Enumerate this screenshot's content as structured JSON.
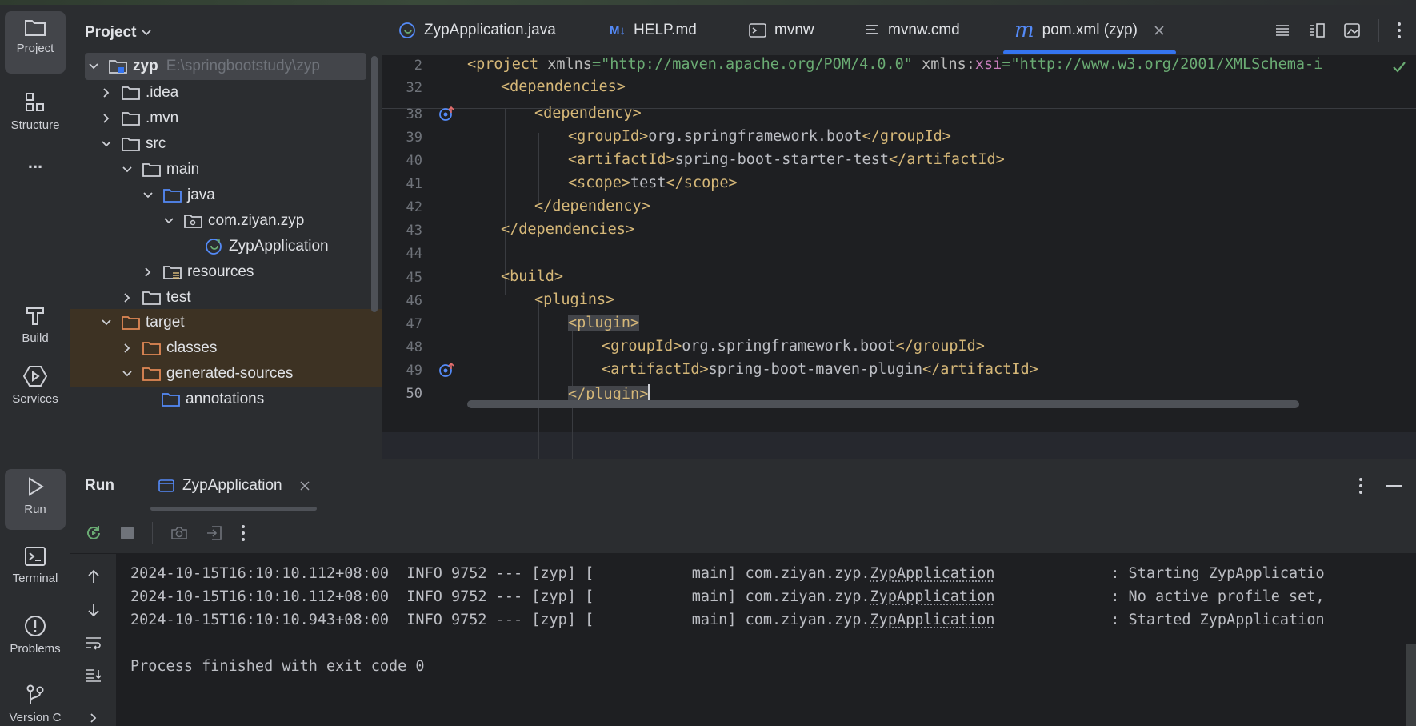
{
  "colors": {
    "accent": "#3574f0",
    "tag": "#d5b778",
    "string": "#6aab73",
    "excluded": "#3d3223"
  },
  "toolstrip": {
    "project": "Project",
    "structure": "Structure",
    "more": "...",
    "build": "Build",
    "services": "Services",
    "run": "Run",
    "terminal": "Terminal",
    "problems": "Problems",
    "version": "Version C"
  },
  "project": {
    "title": "Project",
    "tree": [
      {
        "label": "zyp",
        "path": "E:\\springbootstudy\\zyp"
      },
      {
        "label": ".idea"
      },
      {
        "label": ".mvn"
      },
      {
        "label": "src"
      },
      {
        "label": "main"
      },
      {
        "label": "java"
      },
      {
        "label": "com.ziyan.zyp"
      },
      {
        "label": "ZypApplication"
      },
      {
        "label": "resources"
      },
      {
        "label": "test"
      },
      {
        "label": "target"
      },
      {
        "label": "classes"
      },
      {
        "label": "generated-sources"
      },
      {
        "label": "annotations"
      }
    ]
  },
  "tabs": [
    {
      "label": "ZypApplication.java",
      "icon": "spring-run-icon"
    },
    {
      "label": "HELP.md",
      "icon": "markdown-icon"
    },
    {
      "label": "mvnw",
      "icon": "terminal-icon"
    },
    {
      "label": "mvnw.cmd",
      "icon": "text-file-icon"
    },
    {
      "label": "pom.xml (zyp)",
      "icon": "maven-icon",
      "active": true
    }
  ],
  "editor": {
    "sticky": [
      {
        "num": "2",
        "text": "<project xmlns=\"http://maven.apache.org/POM/4.0.0\" xmlns:xsi=\"http://www.w3.org/2001/XMLSchema-i"
      },
      {
        "num": "32",
        "text": "<dependencies>"
      }
    ],
    "lines": [
      {
        "num": "38",
        "text": "<dependency>"
      },
      {
        "num": "39",
        "text": "<groupId>org.springframework.boot</groupId>"
      },
      {
        "num": "40",
        "text": "<artifactId>spring-boot-starter-test</artifactId>"
      },
      {
        "num": "41",
        "text": "<scope>test</scope>"
      },
      {
        "num": "42",
        "text": "</dependency>"
      },
      {
        "num": "43",
        "text": "</dependencies>"
      },
      {
        "num": "44",
        "text": ""
      },
      {
        "num": "45",
        "text": "<build>"
      },
      {
        "num": "46",
        "text": "<plugins>"
      },
      {
        "num": "47",
        "text": "<plugin>"
      },
      {
        "num": "48",
        "text": "<groupId>org.springframework.boot</groupId>"
      },
      {
        "num": "49",
        "text": "<artifactId>spring-boot-maven-plugin</artifactId>"
      },
      {
        "num": "50",
        "text": "</plugin>"
      }
    ]
  },
  "run": {
    "title": "Run",
    "tab": "ZypApplication",
    "log": [
      {
        "ts": "2024-10-15T16:10:10.112+08:00",
        "level": "INFO",
        "pid": "9752",
        "sep": "---",
        "app": "[zyp] [",
        "thread": "main]",
        "logger_pkg": "com.ziyan.zyp.",
        "logger_cls": "ZypApplication",
        "msg": ": Starting ZypApplicatio"
      },
      {
        "ts": "2024-10-15T16:10:10.112+08:00",
        "level": "INFO",
        "pid": "9752",
        "sep": "---",
        "app": "[zyp] [",
        "thread": "main]",
        "logger_pkg": "com.ziyan.zyp.",
        "logger_cls": "ZypApplication",
        "msg": ": No active profile set,"
      },
      {
        "ts": "2024-10-15T16:10:10.943+08:00",
        "level": "INFO",
        "pid": "9752",
        "sep": "---",
        "app": "[zyp] [",
        "thread": "main]",
        "logger_pkg": "com.ziyan.zyp.",
        "logger_cls": "ZypApplication",
        "msg": ": Started ZypApplication"
      }
    ],
    "exit": "Process finished with exit code 0"
  }
}
